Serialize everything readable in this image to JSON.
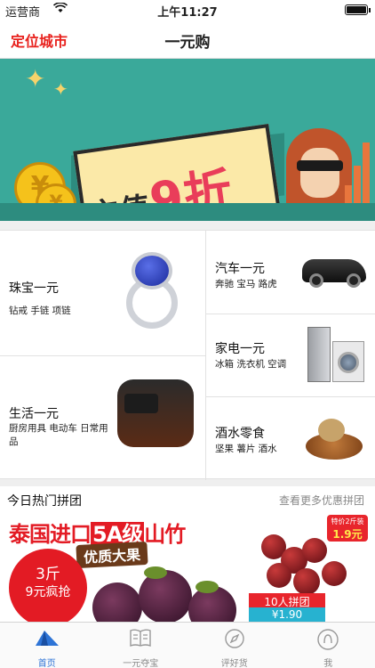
{
  "status_bar": {
    "carrier": "运营商",
    "time": "上午11:27"
  },
  "nav": {
    "city": "定位城市",
    "title": "一元购"
  },
  "banner": {
    "text_main": "充值",
    "text_accent": "9折",
    "page_count": 4,
    "active_index": 0,
    "colors": {
      "bg": "#3aa99a",
      "accent": "#e93d5a",
      "dot_active": "#e5202a",
      "dot": "#1d43c8"
    }
  },
  "categories": [
    {
      "name": "珠宝一元",
      "sub": "钻戒 手链 项链",
      "icon": "ring-image"
    },
    {
      "name": "生活一元",
      "sub": "厨房用具 电动车 日常用品",
      "icon": "rice-cooker-image"
    },
    {
      "name": "汽车一元",
      "sub": "奔驰 宝马 路虎",
      "icon": "car-image"
    },
    {
      "name": "家电一元",
      "sub": "冰箱 洗衣机 空调",
      "icon": "appliance-image"
    },
    {
      "name": "酒水零食",
      "sub": "坚果 薯片 酒水",
      "icon": "snacks-image"
    }
  ],
  "hot": {
    "title": "今日热门拼团",
    "more": "查看更多优惠拼团",
    "poster": {
      "headline_a": "泰国进口",
      "headline_b": "5A级",
      "headline_c": "山竹",
      "ribbon": "优质大果",
      "circle_top": "3斤",
      "circle_bottom": "9元疯抢"
    },
    "side": {
      "tag_small": "特价2斤装",
      "tag_price": "1.9元",
      "badge": "10人拼团",
      "price": "¥1.90"
    }
  },
  "tabs": [
    {
      "label": "首页",
      "icon": "home-tent-icon",
      "active": true
    },
    {
      "label": "一元夺宝",
      "icon": "book-icon",
      "active": false
    },
    {
      "label": "评好货",
      "icon": "compass-icon",
      "active": false
    },
    {
      "label": "我",
      "icon": "profile-icon",
      "active": false
    }
  ]
}
